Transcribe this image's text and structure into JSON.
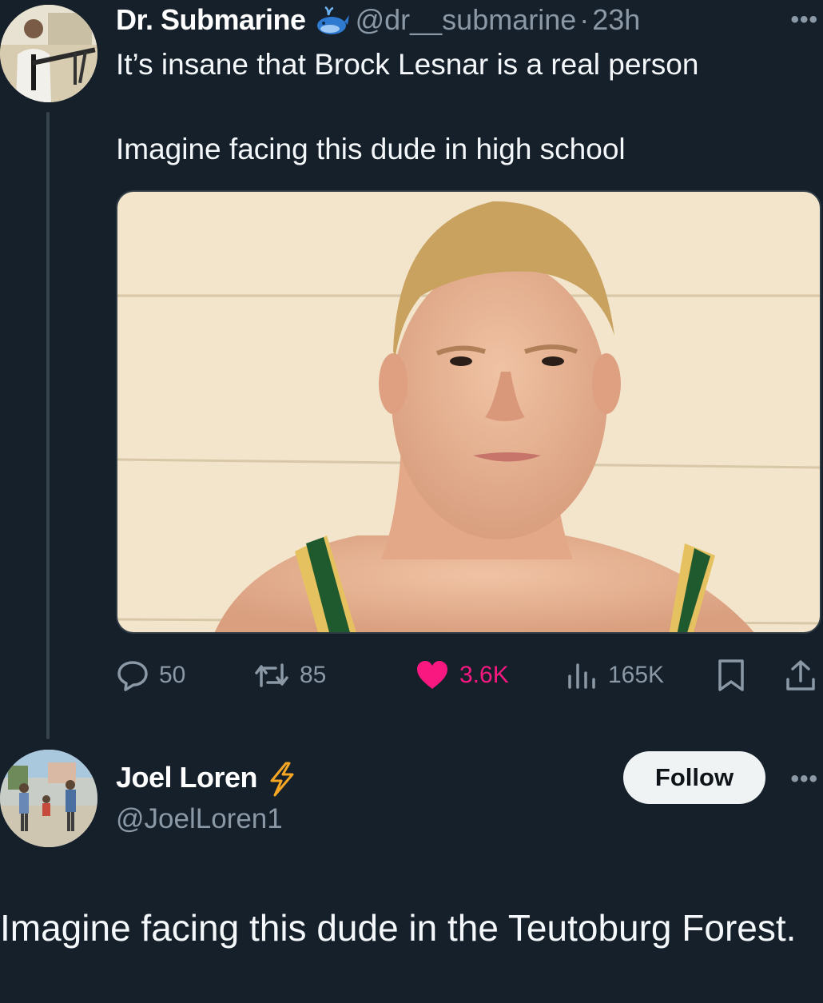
{
  "tweet": {
    "author": {
      "display_name": "Dr. Submarine",
      "badge_icon": "whale-icon",
      "handle": "@dr__submarine",
      "separator": "·",
      "time": "23h"
    },
    "text_line_1": "It’s insane that Brock Lesnar is a real person",
    "text_line_2": "Imagine facing this dude in high school",
    "more_label": "•••",
    "actions": {
      "replies": "50",
      "retweets": "85",
      "likes": "3.6K",
      "views": "165K"
    },
    "colors": {
      "background": "#15202b",
      "muted": "#8b98a5",
      "like": "#f91880"
    }
  },
  "reply_author": {
    "display_name": "Joel Loren",
    "badge_icon": "lightning-icon",
    "handle": "@JoelLoren1",
    "follow_label": "Follow",
    "more_label": "•••"
  },
  "reply_caption": "Imagine facing this dude in the Teutoburg Forest."
}
